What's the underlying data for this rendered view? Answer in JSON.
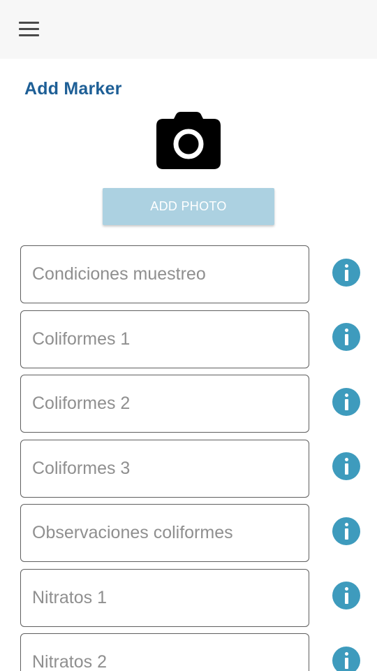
{
  "header": {
    "menu_icon": "hamburger-menu-icon",
    "background": "#f7f7f7"
  },
  "page": {
    "title": "Add Marker",
    "title_color": "#1e5f96"
  },
  "photo": {
    "icon": "camera-icon",
    "button_label": "ADD PHOTO",
    "button_color": "#acd1e1"
  },
  "fields": [
    {
      "placeholder": "Condiciones muestreo",
      "value": "",
      "info_icon": "info-icon"
    },
    {
      "placeholder": "Coliformes 1",
      "value": "",
      "info_icon": "info-icon"
    },
    {
      "placeholder": "Coliformes 2",
      "value": "",
      "info_icon": "info-icon"
    },
    {
      "placeholder": "Coliformes 3",
      "value": "",
      "info_icon": "info-icon"
    },
    {
      "placeholder": "Observaciones coliformes",
      "value": "",
      "info_icon": "info-icon"
    },
    {
      "placeholder": "Nitratos 1",
      "value": "",
      "info_icon": "info-icon"
    },
    {
      "placeholder": "Nitratos 2",
      "value": "",
      "info_icon": "info-icon"
    }
  ],
  "info_icon_color": "#3e9bbd"
}
